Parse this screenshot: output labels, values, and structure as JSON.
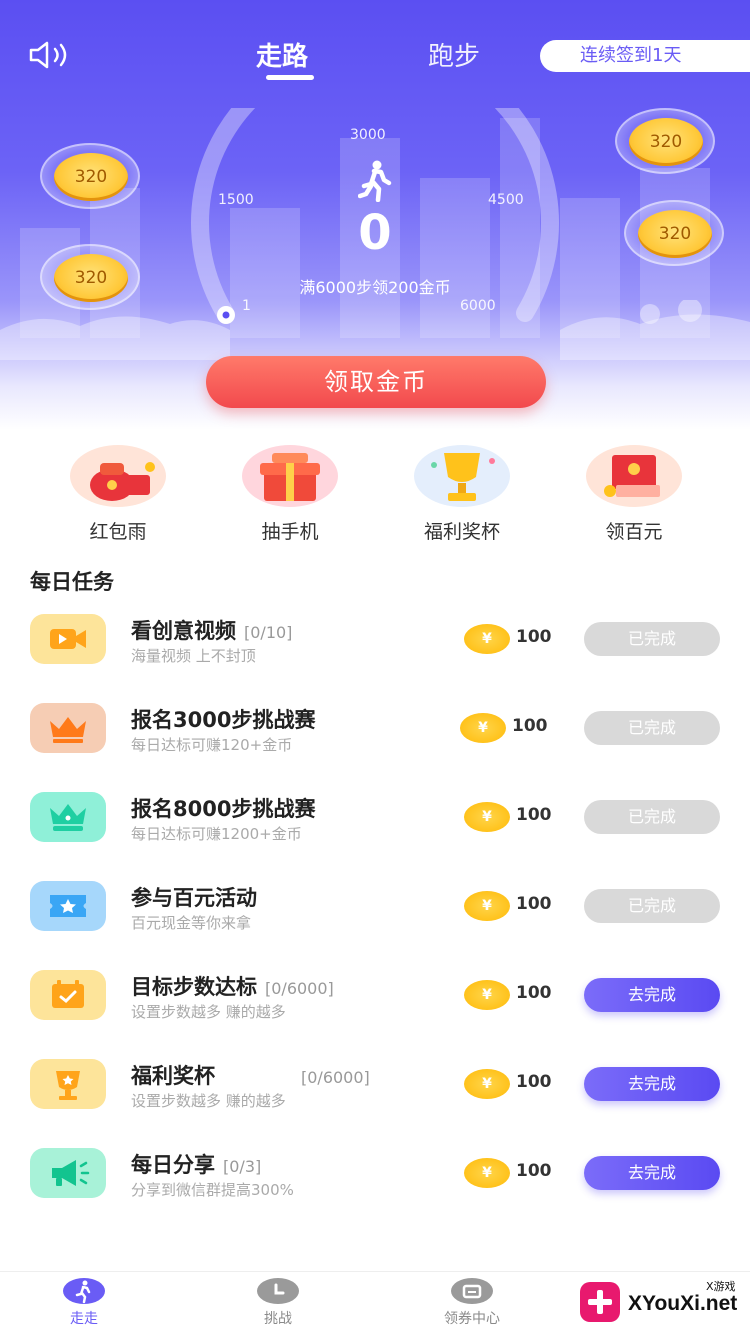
{
  "header": {
    "tabs": [
      {
        "label": "走路"
      },
      {
        "label": "跑步"
      }
    ],
    "signin_label": "连续签到1天"
  },
  "gauge": {
    "ticks": [
      "3000",
      "1500",
      "4500",
      "1",
      "6000"
    ],
    "step_count": "0",
    "goal_text": "满6000步领200金币",
    "progress_fraction": 0
  },
  "bubbles": [
    "320",
    "320",
    "320",
    "320"
  ],
  "claim_button": "领取金币",
  "quick_actions": [
    {
      "label": "红包雨",
      "icon": "red-envelope-icon"
    },
    {
      "label": "抽手机",
      "icon": "gift-box-icon"
    },
    {
      "label": "福利奖杯",
      "icon": "trophy-icon"
    },
    {
      "label": "领百元",
      "icon": "cash-envelope-icon"
    }
  ],
  "daily_tasks": {
    "title": "每日任务",
    "items": [
      {
        "title": "看创意视频",
        "progress": "[0/10]",
        "sub": "海量视频 上不封顶",
        "reward": "100",
        "button": "已完成",
        "status": "done",
        "icon": "video-icon",
        "icon_color": "#fde49a"
      },
      {
        "title": "报名3000步挑战赛",
        "progress": "",
        "sub": "每日达标可赚120+金币",
        "reward": "100",
        "button": "已完成",
        "status": "done",
        "icon": "crown-icon",
        "icon_color": "#f6cdb4"
      },
      {
        "title": "报名8000步挑战赛",
        "progress": "",
        "sub": "每日达标可赚1200+金币",
        "reward": "100",
        "button": "已完成",
        "status": "done",
        "icon": "crown-icon",
        "icon_color": "#8ff0d8"
      },
      {
        "title": "参与百元活动",
        "progress": "",
        "sub": "百元现金等你来拿",
        "reward": "100",
        "button": "已完成",
        "status": "done",
        "icon": "ticket-icon",
        "icon_color": "#a6d7fb"
      },
      {
        "title": "目标步数达标",
        "progress": "[0/6000]",
        "sub": "设置步数越多 赚的越多",
        "reward": "100",
        "button": "去完成",
        "status": "todo",
        "icon": "calendar-icon",
        "icon_color": "#fde49a"
      },
      {
        "title": "福利奖杯",
        "progress": "[0/6000]",
        "sub": "设置步数越多 赚的越多",
        "reward": "100",
        "button": "去完成",
        "status": "todo",
        "icon": "trophy-icon",
        "icon_color": "#fde49a"
      },
      {
        "title": "每日分享",
        "progress": "[0/3]",
        "sub": "分享到微信群提高300%",
        "reward": "100",
        "button": "去完成",
        "status": "todo",
        "icon": "megaphone-icon",
        "icon_color": "#a8f2d8"
      }
    ]
  },
  "tabbar": [
    {
      "label": "走走",
      "icon": "walk-icon",
      "active": true
    },
    {
      "label": "挑战",
      "icon": "clock-icon",
      "active": false
    },
    {
      "label": "领券中心",
      "icon": "coupon-icon",
      "active": false
    }
  ],
  "watermark": {
    "text": "XYouXi.net",
    "small": "X游戏"
  },
  "colors": {
    "accent": "#6a5cf5",
    "claim": "#f2494d",
    "coin": "#ffc21b",
    "done": "#d9d9d9"
  }
}
